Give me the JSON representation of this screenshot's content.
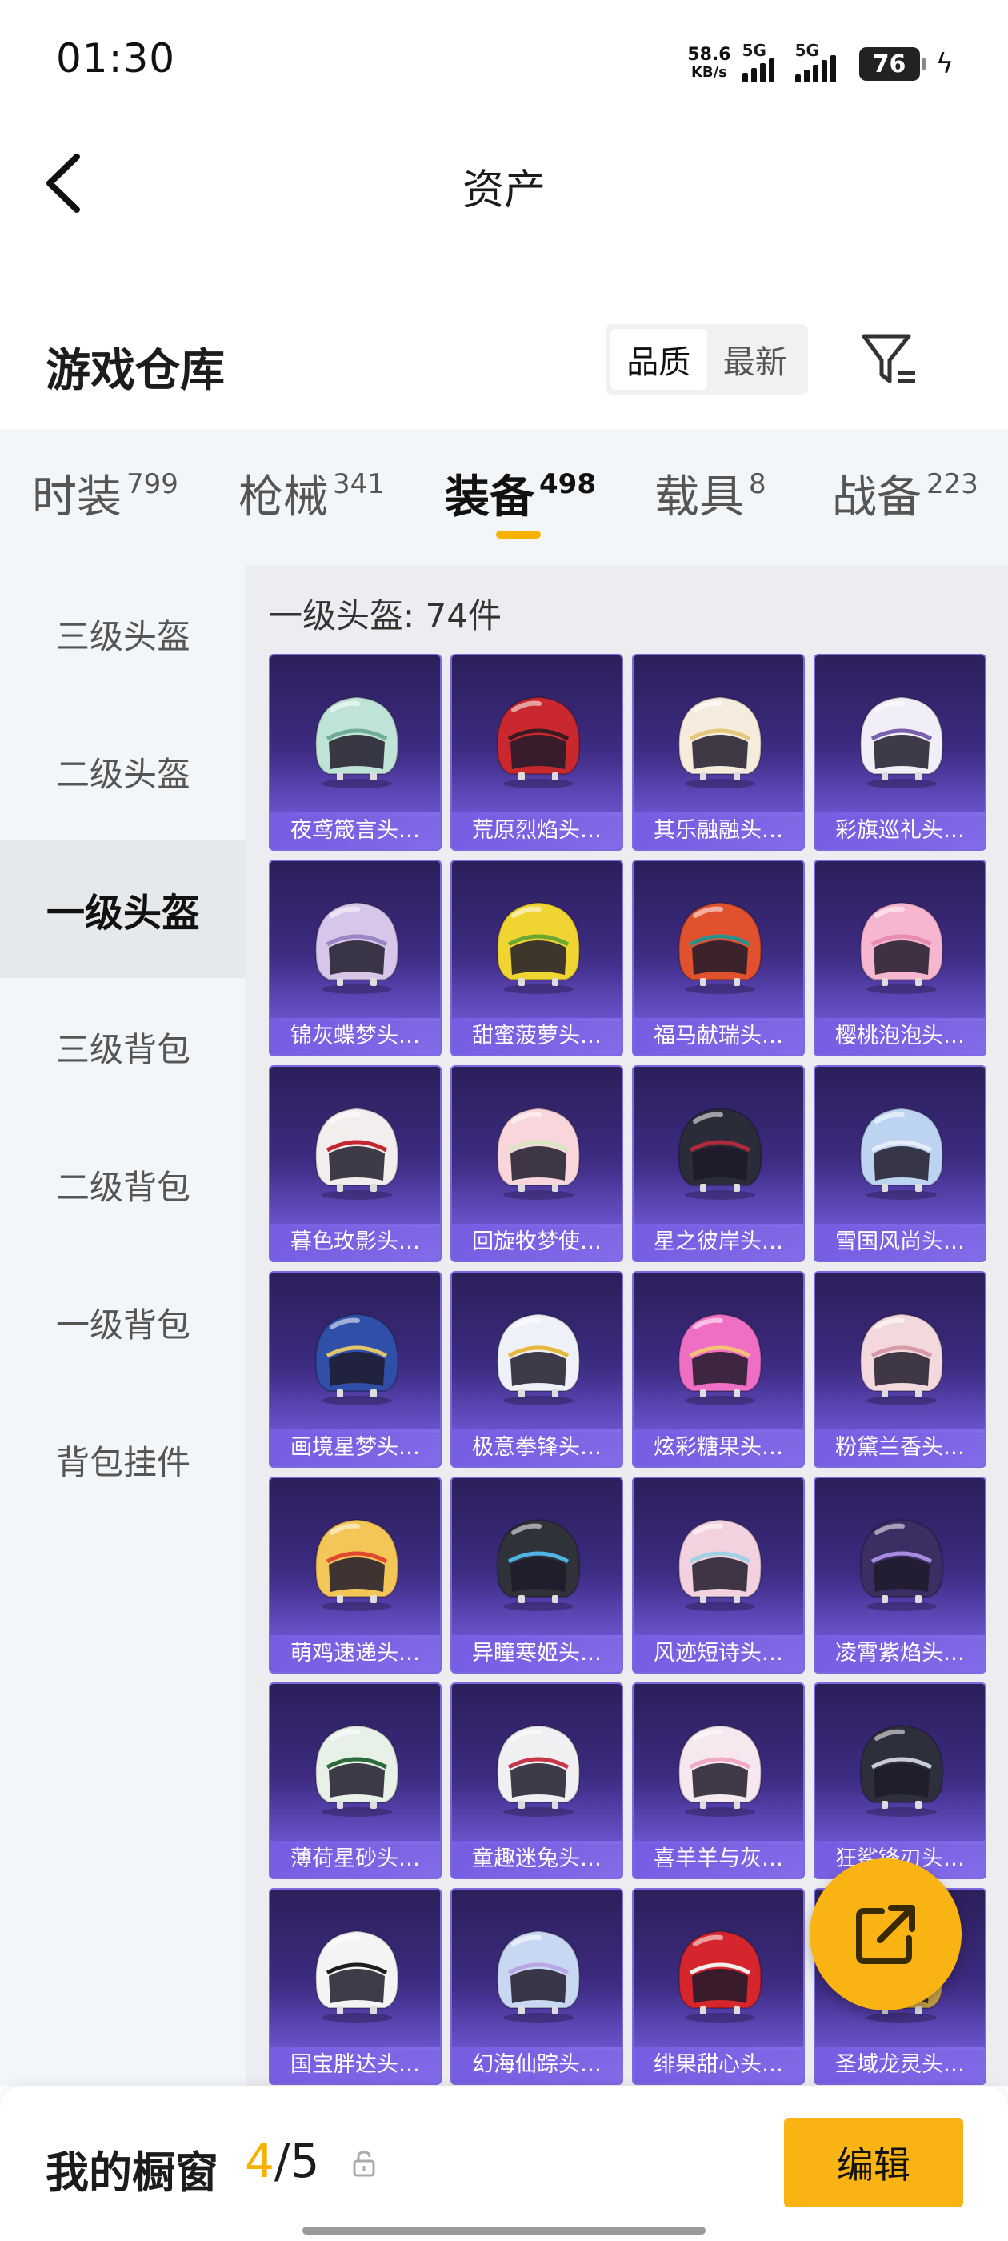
{
  "status_bar": {
    "time": "01:30",
    "net_speed_value": "58.6",
    "net_speed_unit": "KB/s",
    "sim1": "5G",
    "sim2": "5G",
    "battery": "76"
  },
  "header": {
    "title": "资产",
    "back_icon": "chevron-left-icon"
  },
  "warehouse": {
    "title": "游戏仓库",
    "sort_options": [
      "品质",
      "最新"
    ],
    "sort_active": "品质",
    "filter_icon": "filter-icon"
  },
  "tabs": [
    {
      "label": "时装",
      "count": "799"
    },
    {
      "label": "枪械",
      "count": "341"
    },
    {
      "label": "装备",
      "count": "498"
    },
    {
      "label": "载具",
      "count": "8"
    },
    {
      "label": "战备",
      "count": "223"
    }
  ],
  "active_tab": "装备",
  "sidebar": {
    "items": [
      "三级头盔",
      "二级头盔",
      "一级头盔",
      "三级背包",
      "二级背包",
      "一级背包",
      "背包挂件"
    ],
    "active": "一级头盔"
  },
  "grid": {
    "count_label": "一级头盔: 74件",
    "items": [
      {
        "name": "夜鸢箴言头…",
        "color": "#bfe3d6",
        "accent": "#6fae95"
      },
      {
        "name": "荒原烈焰头…",
        "color": "#c8282e",
        "accent": "#3a1a22"
      },
      {
        "name": "其乐融融头…",
        "color": "#f5ecde",
        "accent": "#e5c77a"
      },
      {
        "name": "彩旗巡礼头…",
        "color": "#f2eef7",
        "accent": "#7a5fb0"
      },
      {
        "name": "锦灰蝶梦头…",
        "color": "#d7c5ea",
        "accent": "#9c85c4"
      },
      {
        "name": "甜蜜菠萝头…",
        "color": "#f0d431",
        "accent": "#6aa832"
      },
      {
        "name": "福马献瑞头…",
        "color": "#e2512e",
        "accent": "#2f8f8a"
      },
      {
        "name": "樱桃泡泡头…",
        "color": "#f6b6cf",
        "accent": "#e98ab0"
      },
      {
        "name": "暮色玫影头…",
        "color": "#f3eeee",
        "accent": "#c3262c"
      },
      {
        "name": "回旋牧梦使…",
        "color": "#f8d6dc",
        "accent": "#d9e6c2"
      },
      {
        "name": "星之彼岸头…",
        "color": "#2b2c3a",
        "accent": "#b02a3c"
      },
      {
        "name": "雪国风尚头…",
        "color": "#bcd4f2",
        "accent": "#e7eef9"
      },
      {
        "name": "画境星梦头…",
        "color": "#2f4fa8",
        "accent": "#e0c56a"
      },
      {
        "name": "极意拳锋头…",
        "color": "#eef2f8",
        "accent": "#e8b83a"
      },
      {
        "name": "炫彩糖果头…",
        "color": "#ef6fc4",
        "accent": "#f7c074"
      },
      {
        "name": "粉黛兰香头…",
        "color": "#f3d9dd",
        "accent": "#d79aa6"
      },
      {
        "name": "萌鸡速递头…",
        "color": "#f4c657",
        "accent": "#e3462f"
      },
      {
        "name": "异瞳寒姬头…",
        "color": "#30323a",
        "accent": "#4fb3e3"
      },
      {
        "name": "风迹短诗头…",
        "color": "#f3d2df",
        "accent": "#9ed0e6"
      },
      {
        "name": "凌霄紫焰头…",
        "color": "#3a2e63",
        "accent": "#a98ae0"
      },
      {
        "name": "薄荷星砂头…",
        "color": "#e8f1e8",
        "accent": "#2d6b3c"
      },
      {
        "name": "童趣迷兔头…",
        "color": "#f0f0f3",
        "accent": "#c9364a"
      },
      {
        "name": "喜羊羊与灰…",
        "color": "#f7e7ee",
        "accent": "#f2a9c4"
      },
      {
        "name": "狂鲨锋刃头…",
        "color": "#2d2f3c",
        "accent": "#c9ccd6"
      },
      {
        "name": "国宝胖达头…",
        "color": "#f4f4f4",
        "accent": "#1d1d1d"
      },
      {
        "name": "幻海仙踪头…",
        "color": "#c9d8f2",
        "accent": "#b9a6e4"
      },
      {
        "name": "绯果甜心头…",
        "color": "#d5262e",
        "accent": "#f5f0f0"
      },
      {
        "name": "圣域龙灵头…",
        "color": "#c9a24a",
        "accent": "#e7d39b"
      }
    ]
  },
  "fab_icon": "share-icon",
  "bottom_bar": {
    "label": "我的橱窗",
    "current": "4",
    "separator": "/",
    "total": "5",
    "lock_icon": "lock-icon",
    "edit_label": "编辑"
  },
  "colors": {
    "accent": "#f8b100",
    "card_bg": "#3b2a7e",
    "sidebar_bg": "#f3f6f9"
  }
}
